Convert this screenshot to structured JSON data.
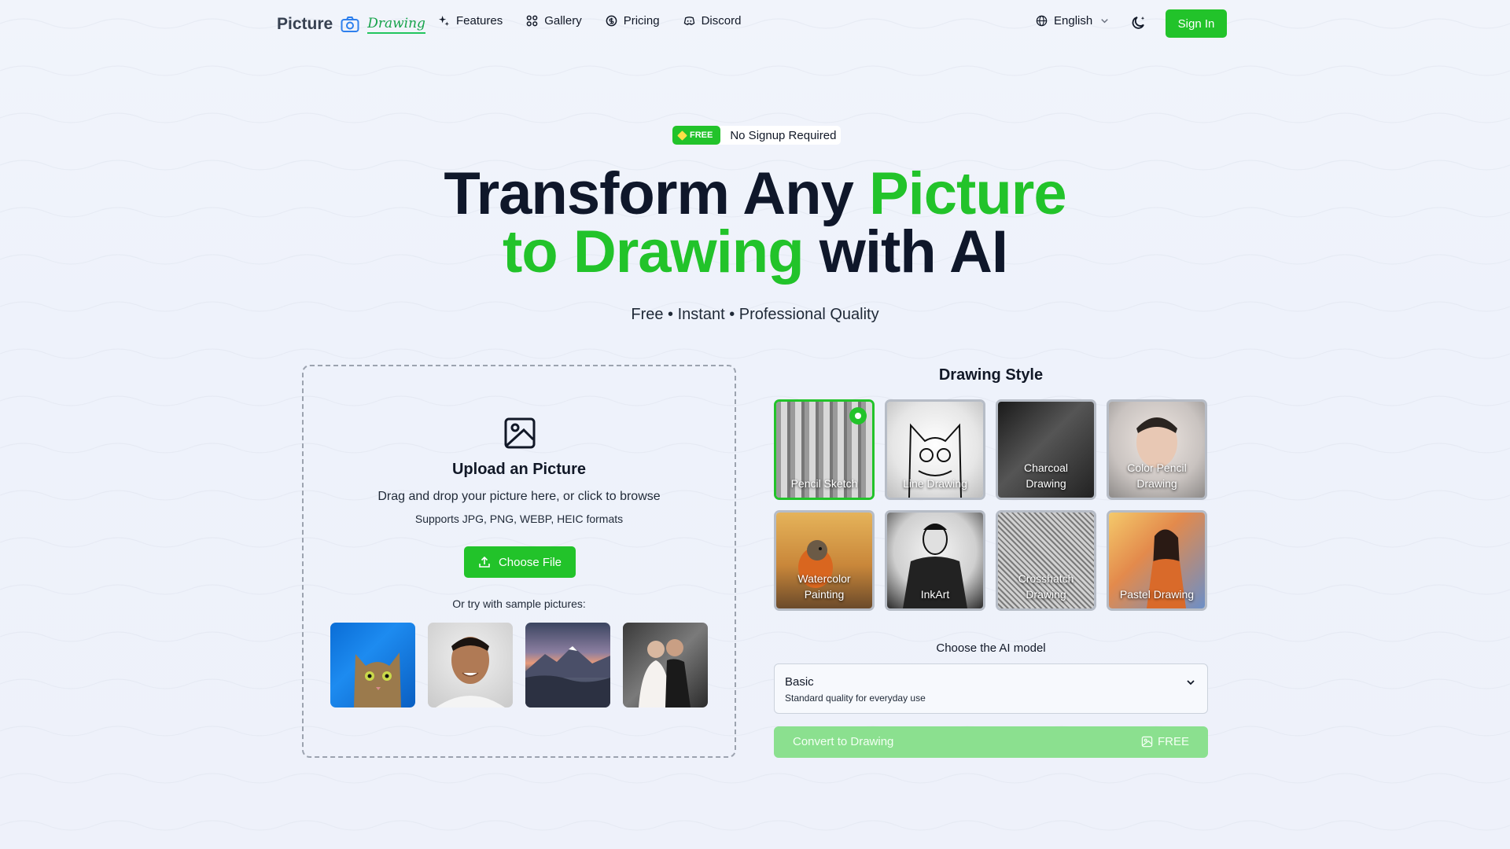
{
  "nav": {
    "logo_text": "Picture",
    "logo_script": "Drawing",
    "links": [
      {
        "label": "Features",
        "icon": "sparkles-icon"
      },
      {
        "label": "Gallery",
        "icon": "grid-icon"
      },
      {
        "label": "Pricing",
        "icon": "dollar-circle-icon"
      },
      {
        "label": "Discord",
        "icon": "discord-icon"
      }
    ],
    "language": "English",
    "signin": "Sign In"
  },
  "hero": {
    "badge_free": "FREE",
    "badge_text": "No Signup Required",
    "title_part1": "Transform Any ",
    "title_highlight1": "Picture",
    "title_highlight2": "to Drawing",
    "title_part2": " with AI",
    "subtitle": "Free • Instant • Professional Quality"
  },
  "upload": {
    "title": "Upload an Picture",
    "description": "Drag and drop your picture here, or click to browse",
    "formats": "Supports JPG, PNG, WEBP, HEIC formats",
    "button": "Choose File",
    "samples_label": "Or try with sample pictures:"
  },
  "styles": {
    "title": "Drawing Style",
    "selected": "Pencil Sketch",
    "items": [
      {
        "label": "Pencil Sketch"
      },
      {
        "label": "Line Drawing"
      },
      {
        "label": "Charcoal Drawing"
      },
      {
        "label": "Color Pencil Drawing"
      },
      {
        "label": "Watercolor Painting"
      },
      {
        "label": "InkArt"
      },
      {
        "label": "Crosshatch Drawing"
      },
      {
        "label": "Pastel Drawing"
      }
    ]
  },
  "model": {
    "label": "Choose the AI model",
    "name": "Basic",
    "description": "Standard quality for everyday use"
  },
  "convert": {
    "label": "Convert to Drawing",
    "badge": "FREE"
  },
  "colors": {
    "accent": "#22c32a",
    "text": "#0f172a"
  }
}
